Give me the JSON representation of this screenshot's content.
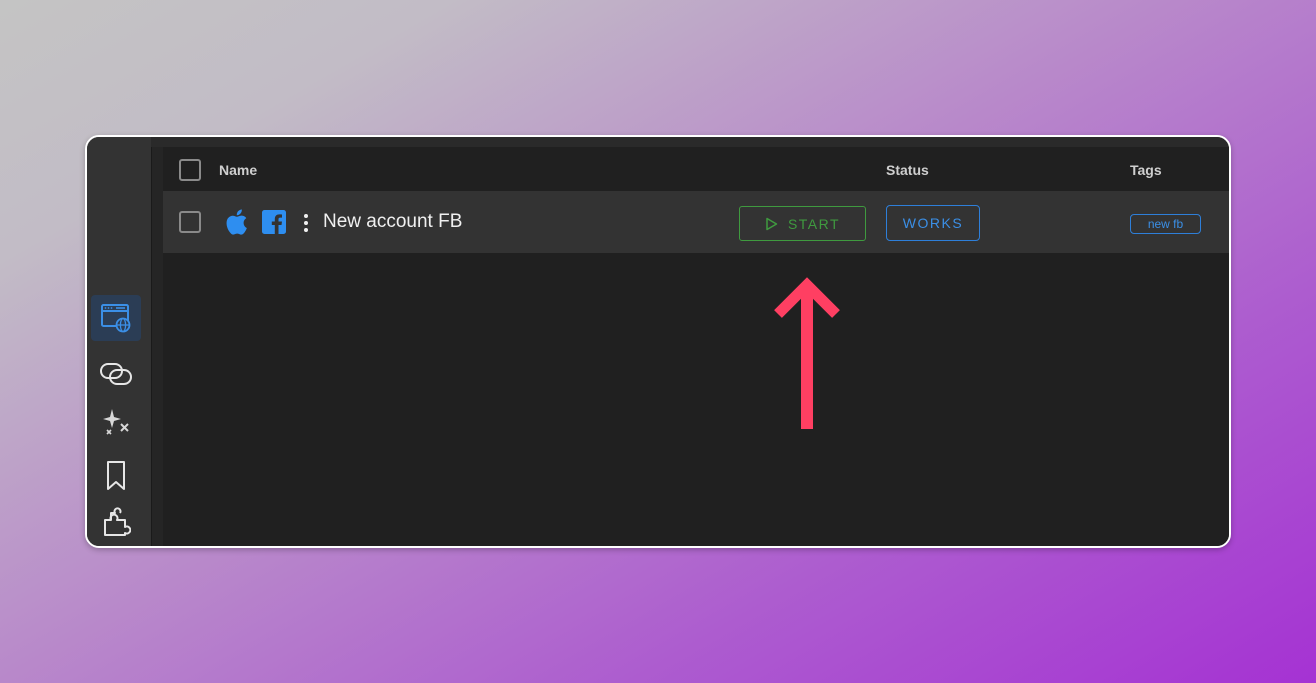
{
  "table": {
    "headers": {
      "name": "Name",
      "status": "Status",
      "tags": "Tags"
    },
    "rows": [
      {
        "os_icon": "apple-icon",
        "social_icon": "facebook-icon",
        "name": "New account FB",
        "start_label": "START",
        "status": "WORKS",
        "tag": "new fb"
      }
    ]
  },
  "sidebar": {
    "items": [
      {
        "icon": "browser-profiles-icon",
        "active": true
      },
      {
        "icon": "proxy-link-icon",
        "active": false
      },
      {
        "icon": "sparkles-icon",
        "active": false
      },
      {
        "icon": "bookmark-icon",
        "active": false
      },
      {
        "icon": "puzzle-extension-icon",
        "active": false
      }
    ]
  },
  "colors": {
    "accent_blue": "#2e7fd9",
    "start_green": "#3f9a3f",
    "arrow_red": "#ff3f62",
    "row_bg": "#333333",
    "panel_bg": "#202020"
  },
  "annotation": {
    "icon": "arrow-up-icon"
  }
}
